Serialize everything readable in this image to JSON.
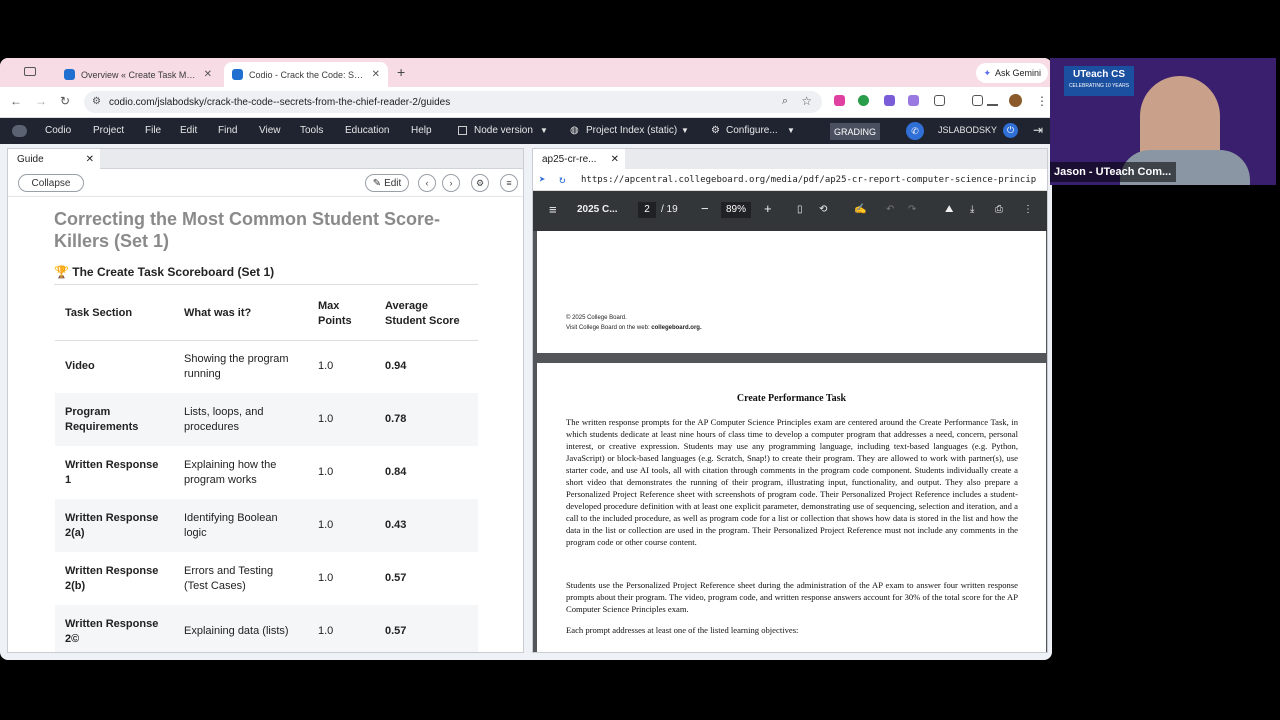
{
  "browser": {
    "tabs": [
      {
        "label": "Overview « Create Task Master",
        "active": false
      },
      {
        "label": "Codio - Crack the Code: Secrets",
        "active": true
      }
    ],
    "gemini_label": "Ask Gemini",
    "url": "codio.com/jslabodsky/crack-the-code--secrets-from-the-chief-reader-2/guides"
  },
  "appbar": {
    "menu": [
      "Codio",
      "Project",
      "File",
      "Edit",
      "Find",
      "View",
      "Tools",
      "Education",
      "Help"
    ],
    "node_version": "Node version",
    "project_index": "Project Index (static)",
    "configure": "Configure...",
    "grading": "GRADING",
    "user": "JSLABODSKY"
  },
  "guide": {
    "tab_label": "Guide",
    "collapse_label": "Collapse",
    "edit_label": "Edit",
    "title": "Correcting the Most Common Student Score-Killers (Set 1)",
    "subtitle": "🏆 The Create Task Scoreboard (Set 1)",
    "table": {
      "headers": [
        "Task Section",
        "What was it?",
        "Max Points",
        "Average Student Score"
      ],
      "rows": [
        [
          "Video",
          "Showing the program running",
          "1.0",
          "0.94"
        ],
        [
          "Program Requirements",
          "Lists, loops, and procedures",
          "1.0",
          "0.78"
        ],
        [
          "Written Response 1",
          "Explaining how the program works",
          "1.0",
          "0.84"
        ],
        [
          "Written Response 2(a)",
          "Identifying Boolean logic",
          "1.0",
          "0.43"
        ],
        [
          "Written Response 2(b)",
          "Errors and Testing (Test Cases)",
          "1.0",
          "0.57"
        ],
        [
          "Written Response 2©",
          "Explaining data (lists)",
          "1.0",
          "0.57"
        ]
      ]
    }
  },
  "pdf": {
    "tab_label": "ap25-cr-re...",
    "url": "https://apcentral.collegeboard.org/media/pdf/ap25-cr-report-computer-science-princip",
    "doc_title": "2025 C...",
    "page_current": "2",
    "page_total": "/ 19",
    "zoom": "89%",
    "footer_line1": "© 2025 College Board.",
    "footer_line2_prefix": "Visit College Board on the web: ",
    "footer_line2_link": "collegeboard.org.",
    "heading": "Create Performance Task",
    "para1": "The written response prompts for the AP Computer Science Principles exam are centered around the Create Performance Task, in which students dedicate at least nine hours of class time to develop a computer program that addresses a need, concern, personal interest, or creative expression. Students may use any programming language, including text-based languages (e.g. Python, JavaScript) or block-based languages (e.g. Scratch, Snap!) to create their program. They are allowed to work with partner(s), use starter code, and use AI tools, all with citation through comments in the program code component. Students individually create a short video that demonstrates the running of their program, illustrating input, functionality, and output. They also prepare a Personalized Project Reference sheet with screenshots of program code. Their Personalized Project Reference includes a student-developed procedure definition with at least one explicit parameter, demonstrating use of sequencing, selection and iteration, and a call to the included procedure, as well as program code for a list or collection that shows how data is stored in the list and how the data in the list or collection are used in the program. Their Personalized Project Reference must not include any comments in the program code or other course content.",
    "para2": "Students use the Personalized Project Reference sheet during the administration of the AP exam to answer four written response prompts about their program. The video, program code, and written response answers account for 30% of the total score for the AP Computer Science Principles exam.",
    "para3": "Each prompt addresses at least one of the listed learning objectives:"
  },
  "webcam": {
    "logo": "UTeach CS",
    "logo_sub": "CELEBRATING 10 YEARS",
    "name": "Jason - UTeach Com..."
  }
}
